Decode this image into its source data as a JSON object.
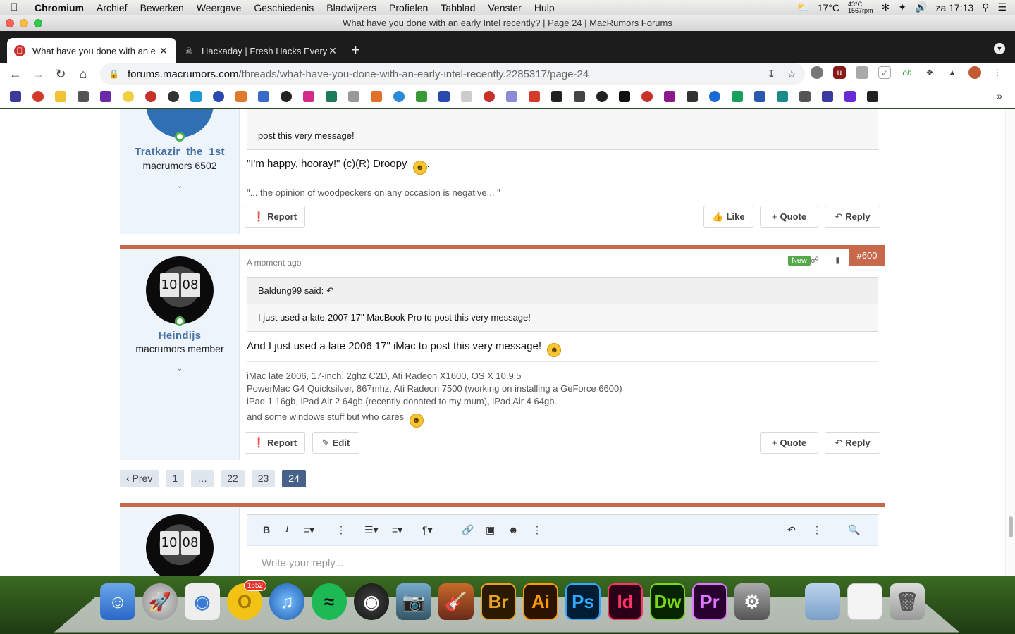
{
  "menubar": {
    "app": "Chromium",
    "items": [
      "Archief",
      "Bewerken",
      "Weergave",
      "Geschiedenis",
      "Bladwijzers",
      "Profielen",
      "Tabblad",
      "Venster",
      "Hulp"
    ],
    "weather": "17°C",
    "cpu_temp": "43°C",
    "fan": "1567rpm",
    "clock": "za 17:13"
  },
  "window": {
    "title": "What have you done with an early Intel recently? | Page 24 | MacRumors Forums"
  },
  "tabs": [
    {
      "title": "What have you done with an e",
      "active": true
    },
    {
      "title": "Hackaday | Fresh Hacks Every",
      "active": false
    }
  ],
  "omnibox": {
    "host": "forums.macrumors.com",
    "path": "/threads/what-have-you-done-with-an-early-intel-recently.2285317/page-24"
  },
  "post1": {
    "username": "Tratkazir_the_1st",
    "user_title": "macrumors 6502",
    "quote_body": "post this very message!",
    "message": "\"I'm happy, hooray!\" (c)(R) Droopy",
    "message_suffix": ".",
    "signature": "\"... the opinion of woodpeckers on any occasion is negative... \"",
    "buttons": {
      "report": "Report",
      "like": "Like",
      "quote": "Quote",
      "reply": "Reply"
    }
  },
  "post2": {
    "time": "A moment ago",
    "badge": "New",
    "number": "#600",
    "username": "Heindijs",
    "user_title": "macrumors member",
    "quote_author": "Baldung99 said:",
    "quote_body": "I just used a late-2007 17\" MacBook Pro to post this very message!",
    "message": "And I just used a late 2006 17\" iMac to post this very message!",
    "signature_lines": [
      "iMac late 2006, 17-inch, 2ghz C2D, Ati Radeon X1600, OS X 10.9.5",
      "PowerMac G4 Quicksilver, 867mhz, Ati Radeon 7500 (working on installing a GeForce 6600)",
      "iPad 1 16gb, iPad Air 2 64gb (recently donated to my mum), iPad Air 4 64gb.",
      "and some windows stuff but who cares"
    ],
    "buttons": {
      "report": "Report",
      "edit": "Edit",
      "quote": "Quote",
      "reply": "Reply"
    }
  },
  "pagination": {
    "prev": "‹ Prev",
    "pages": [
      "1",
      "…",
      "22",
      "23",
      "24"
    ],
    "current": "24"
  },
  "editor": {
    "placeholder": "Write your reply..."
  },
  "dock": {
    "mail_badge": "1652",
    "apps": [
      "Br",
      "Ai",
      "Ps",
      "Id",
      "Dw",
      "Pr"
    ]
  },
  "avatar_digits": [
    "10",
    "08"
  ],
  "colors": {
    "accent": "#c8684a",
    "username": "#4771a5",
    "page_current": "#47628a",
    "new_badge": "#55a94a"
  }
}
